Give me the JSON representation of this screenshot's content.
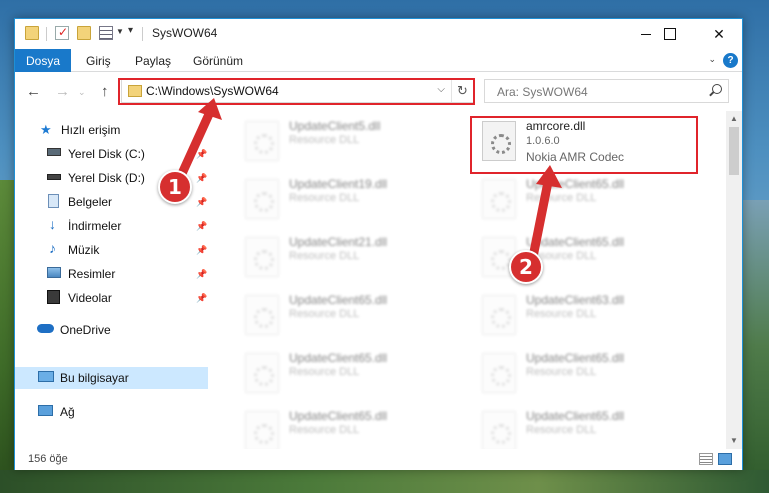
{
  "window": {
    "title": "SysWOW64",
    "close_glyph": "✕"
  },
  "ribbon": {
    "tabs": [
      "Dosya",
      "Giriş",
      "Paylaş",
      "Görünüm"
    ],
    "help": "?"
  },
  "nav_buttons": {
    "back": "←",
    "forward": "→",
    "up": "↑"
  },
  "address": {
    "path": "C:\\Windows\\SysWOW64",
    "refresh": "↻",
    "dropdown": "⌵"
  },
  "search": {
    "placeholder": "Ara: SysWOW64"
  },
  "sidebar": {
    "items": [
      {
        "label": "Hızlı erişim",
        "icon": "star-icon"
      },
      {
        "label": "Yerel Disk (C:)",
        "icon": "drive-icon",
        "pinned": true
      },
      {
        "label": "Yerel Disk (D:)",
        "icon": "drive-icon",
        "pinned": true
      },
      {
        "label": "Belgeler",
        "icon": "documents-icon",
        "pinned": true
      },
      {
        "label": "İndirmeler",
        "icon": "download-icon",
        "pinned": true
      },
      {
        "label": "Müzik",
        "icon": "music-icon",
        "pinned": true
      },
      {
        "label": "Resimler",
        "icon": "pictures-icon",
        "pinned": true
      },
      {
        "label": "Videolar",
        "icon": "video-icon",
        "pinned": true
      },
      {
        "label": "OneDrive",
        "icon": "cloud-icon"
      },
      {
        "label": "Bu bilgisayar",
        "icon": "computer-icon",
        "selected": true
      },
      {
        "label": "Ağ",
        "icon": "network-icon"
      }
    ]
  },
  "files": {
    "left_column": [
      {
        "name": "UpdateClient5.dll",
        "type": "Resource DLL"
      },
      {
        "name": "UpdateClient19.dll",
        "type": "Resource DLL"
      },
      {
        "name": "UpdateClient21.dll",
        "type": "Resource DLL"
      },
      {
        "name": "UpdateClient65.dll",
        "type": "Resource DLL"
      },
      {
        "name": "UpdateClient65.dll",
        "type": "Resource DLL"
      },
      {
        "name": "UpdateClient65.dll",
        "type": "Resource DLL"
      }
    ],
    "right_column": [
      {
        "name": "UpdateClient65.dll",
        "type": "Resource DLL"
      },
      {
        "name": "UpdateClient65.dll",
        "type": "Resource DLL"
      },
      {
        "name": "UpdateClient63.dll",
        "type": "Resource DLL"
      },
      {
        "name": "UpdateClient65.dll",
        "type": "Resource DLL"
      },
      {
        "name": "UpdateClient65.dll",
        "type": "Resource DLL"
      }
    ],
    "highlighted": {
      "name": "amrcore.dll",
      "version": "1.0.6.0",
      "company": "Nokia AMR Codec"
    }
  },
  "status": {
    "count": "156 öğe"
  },
  "annotations": {
    "badge1": "1",
    "badge2": "2",
    "color": "#d62f2f"
  }
}
